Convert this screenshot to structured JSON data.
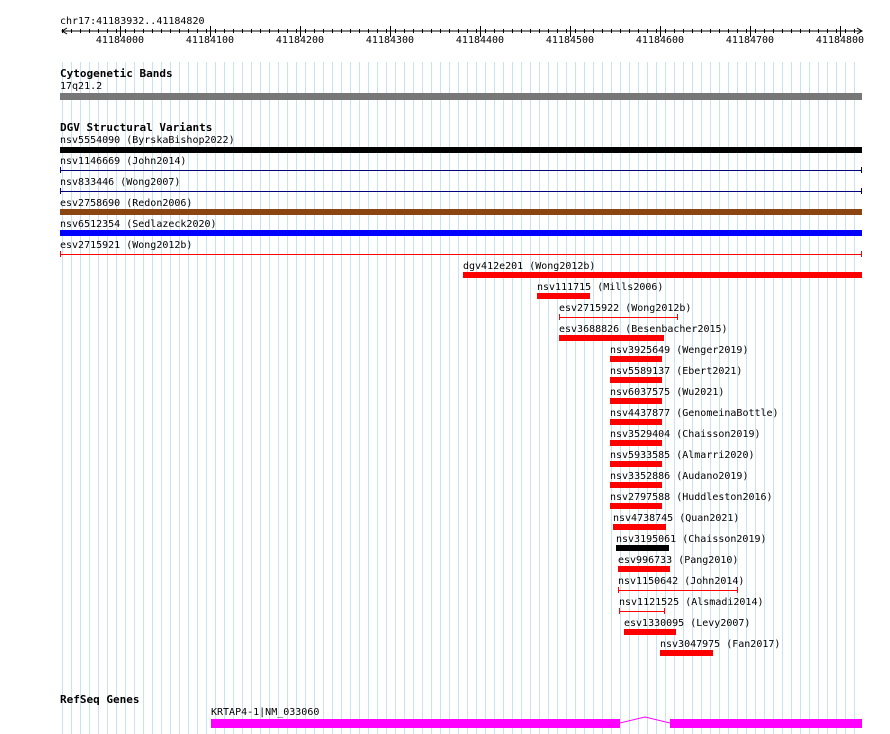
{
  "region": "chr17:41183932..41184820",
  "ruler_ticks": [
    "41184000",
    "41184100",
    "41184200",
    "41184300",
    "41184400",
    "41184500",
    "41184600",
    "41184700",
    "41184800"
  ],
  "tracks": {
    "cyto": {
      "title": "Cytogenetic Bands",
      "band": "17q21.2",
      "color": "#777777"
    },
    "dgv": {
      "title": "DGV Structural Variants",
      "features": [
        {
          "label": "nsv5554090 (ByrskaBishop2022)",
          "style": "bar",
          "color": "#000000"
        },
        {
          "label": "nsv1146669 (John2014)",
          "style": "line",
          "color": "#00007f"
        },
        {
          "label": "nsv833446 (Wong2007)",
          "style": "line",
          "color": "#00007f"
        },
        {
          "label": "esv2758690 (Redon2006)",
          "style": "bar",
          "color": "#8b4513"
        },
        {
          "label": "nsv6512354 (Sedlazeck2020)",
          "style": "bar",
          "color": "#0000ff"
        },
        {
          "label": "esv2715921 (Wong2012b)",
          "style": "line",
          "color": "#ff0000"
        },
        {
          "label": "dgv412e201 (Wong2012b)",
          "style": "bar",
          "color": "#ff0000"
        },
        {
          "label": "nsv111715 (Mills2006)",
          "style": "bar",
          "color": "#ff0000"
        },
        {
          "label": "esv2715922 (Wong2012b)",
          "style": "line",
          "color": "#ff0000"
        },
        {
          "label": "esv3688826 (Besenbacher2015)",
          "style": "bar",
          "color": "#ff0000"
        },
        {
          "label": "nsv3925649 (Wenger2019)",
          "style": "bar",
          "color": "#ff0000"
        },
        {
          "label": "nsv5589137 (Ebert2021)",
          "style": "bar",
          "color": "#ff0000"
        },
        {
          "label": "nsv6037575 (Wu2021)",
          "style": "bar",
          "color": "#ff0000"
        },
        {
          "label": "nsv4437877 (GenomeinaBottle)",
          "style": "bar",
          "color": "#ff0000"
        },
        {
          "label": "nsv3529404 (Chaisson2019)",
          "style": "bar",
          "color": "#ff0000"
        },
        {
          "label": "nsv5933585 (Almarri2020)",
          "style": "bar",
          "color": "#ff0000"
        },
        {
          "label": "nsv3352886 (Audano2019)",
          "style": "bar",
          "color": "#ff0000"
        },
        {
          "label": "nsv2797588 (Huddleston2016)",
          "style": "bar",
          "color": "#ff0000"
        },
        {
          "label": "nsv4738745 (Quan2021)",
          "style": "bar",
          "color": "#ff0000"
        },
        {
          "label": "nsv3195061 (Chaisson2019)",
          "style": "bar",
          "color": "#000000"
        },
        {
          "label": "esv996733 (Pang2010)",
          "style": "bar",
          "color": "#ff0000"
        },
        {
          "label": "nsv1150642 (John2014)",
          "style": "line",
          "color": "#ff0000"
        },
        {
          "label": "nsv1121525 (Alsmadi2014)",
          "style": "line",
          "color": "#ff0000"
        },
        {
          "label": "esv1330095 (Levy2007)",
          "style": "bar",
          "color": "#ff0000"
        },
        {
          "label": "nsv3047975 (Fan2017)",
          "style": "bar",
          "color": "#ff0000"
        }
      ]
    },
    "refseq": {
      "title": "RefSeq Genes",
      "gene_label": "KRTAP4-1|NM_033060",
      "color": "#ff00ff"
    }
  }
}
